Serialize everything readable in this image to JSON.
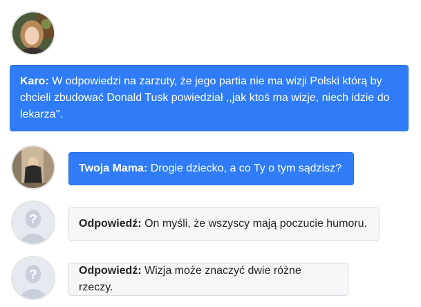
{
  "messages": [
    {
      "author": "Karo:",
      "text": " W odpowiedzi na zarzuty, że jego partia nie ma wizji Polski którą by chcieli zbudować Donald Tusk powiedział ,,jak ktoś ma wizje, niech idzie do lekarza''.",
      "avatar": "karo-avatar"
    },
    {
      "author": "Twoja Mama:",
      "text": " Drogie dziecko, a co Ty o tym sądzisz?",
      "avatar": "mom-avatar"
    },
    {
      "author": "Odpowiedź:",
      "text": " On myśli, że wszyscy mają poczucie humoru.",
      "avatar": "default-user-icon"
    },
    {
      "author": "Odpowiedź:",
      "text": " Wizja może znaczyć dwie różne rzeczy.",
      "avatar": "default-user-icon"
    }
  ],
  "colors": {
    "blue_bubble": "#2f7cf6",
    "gray_bubble": "#f5f6f7"
  }
}
